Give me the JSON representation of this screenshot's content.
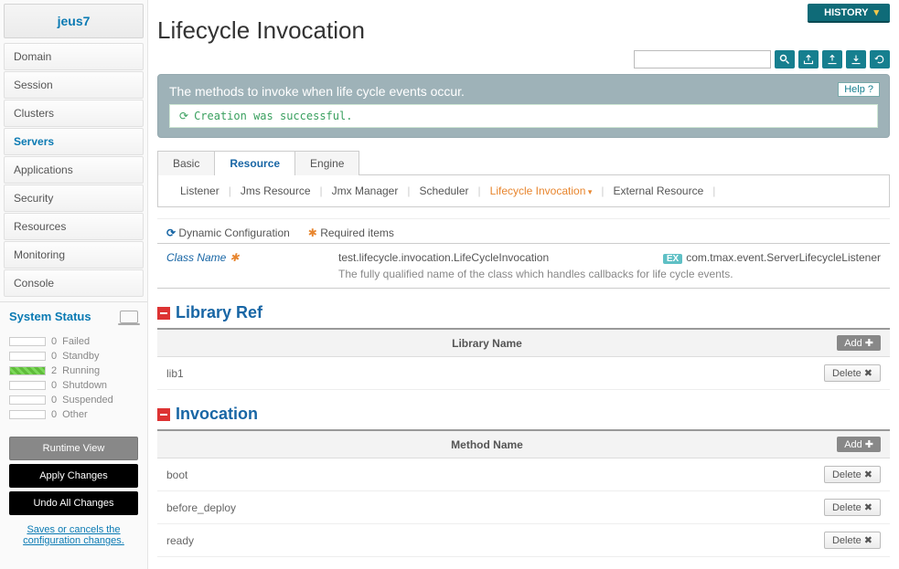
{
  "brand": "jeus7",
  "nav": [
    {
      "label": "Domain"
    },
    {
      "label": "Session"
    },
    {
      "label": "Clusters"
    },
    {
      "label": "Servers",
      "active": true
    },
    {
      "label": "Applications"
    },
    {
      "label": "Security"
    },
    {
      "label": "Resources"
    },
    {
      "label": "Monitoring"
    },
    {
      "label": "Console"
    }
  ],
  "system_status": {
    "title": "System Status",
    "items": [
      {
        "count": 0,
        "label": "Failed",
        "cls": ""
      },
      {
        "count": 0,
        "label": "Standby",
        "cls": ""
      },
      {
        "count": 2,
        "label": "Running",
        "cls": "running"
      },
      {
        "count": 0,
        "label": "Shutdown",
        "cls": ""
      },
      {
        "count": 0,
        "label": "Suspended",
        "cls": ""
      },
      {
        "count": 0,
        "label": "Other",
        "cls": ""
      }
    ]
  },
  "buttons": {
    "runtime": "Runtime View",
    "apply": "Apply Changes",
    "undo": "Undo All Changes",
    "save_note": "Saves or cancels the configuration changes."
  },
  "history": "HISTORY",
  "page_title": "Lifecycle Invocation",
  "banner": {
    "text": "The methods to invoke when life cycle events occur.",
    "help": "Help",
    "success": "Creation was successful."
  },
  "tabs": [
    "Basic",
    "Resource",
    "Engine"
  ],
  "active_tab": 1,
  "subnav": [
    "Listener",
    "Jms Resource",
    "Jmx Manager",
    "Scheduler",
    "Lifecycle Invocation",
    "External Resource"
  ],
  "subnav_active": 4,
  "dyn_label": "Dynamic Configuration",
  "req_label": "Required items",
  "class_name": {
    "label": "Class Name",
    "value": "test.lifecycle.invocation.LifeCycleInvocation",
    "example": "com.tmax.event.ServerLifecycleListener",
    "desc": "The fully qualified name of the class which handles callbacks for life cycle events."
  },
  "library_ref": {
    "title": "Library Ref",
    "header": "Library Name",
    "add": "Add",
    "rows": [
      {
        "name": "lib1"
      }
    ]
  },
  "invocation": {
    "title": "Invocation",
    "header": "Method Name",
    "add": "Add",
    "rows": [
      {
        "name": "boot"
      },
      {
        "name": "before_deploy"
      },
      {
        "name": "ready"
      }
    ]
  },
  "delete_label": "Delete"
}
